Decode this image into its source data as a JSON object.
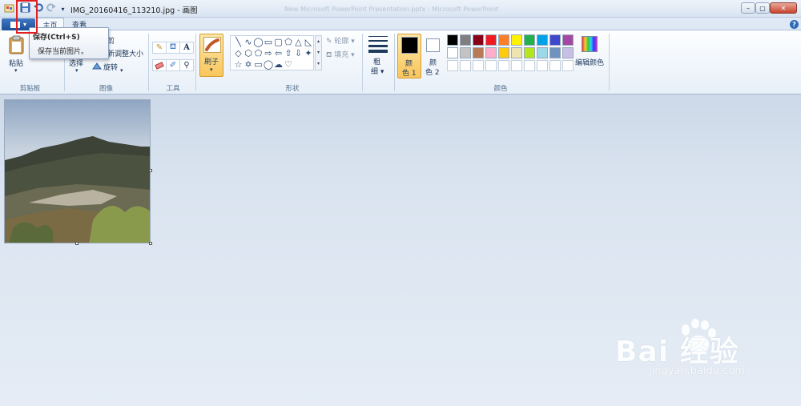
{
  "window": {
    "title": "IMG_20160416_113210.jpg - 画图",
    "ghost_title": "New Microsoft PowerPoint Presentation.pptx - Microsoft PowerPoint",
    "minimize_label": "–",
    "maximize_label": "▢",
    "close_label": "✕"
  },
  "qat": {
    "save_icon": "save-icon",
    "undo_icon": "undo-icon",
    "redo_icon": "redo-icon",
    "customize_label": "▾"
  },
  "tabs": {
    "file_label": "▾",
    "home": "主页",
    "view": "查看",
    "help": "?"
  },
  "tooltip": {
    "title": "保存(Ctrl+S)",
    "description": "保存当前图片。"
  },
  "clipboard": {
    "paste": "粘贴",
    "cut_partial": "剪",
    "group": "剪贴板"
  },
  "image": {
    "select": "选择",
    "resize": "新调整大小",
    "rotate": "旋转",
    "group": "图像"
  },
  "tools": {
    "group": "工具",
    "text_tool": "A"
  },
  "brushes": {
    "label": "刷子"
  },
  "shapes": {
    "outline": "轮廓",
    "fill": "填充",
    "group": "形状",
    "glyphs": [
      "╲",
      "∿",
      "◯",
      "▭",
      "▢",
      "⬠",
      "△",
      "◺",
      "◇",
      "⬡",
      "⬠",
      "⇨",
      "⇦",
      "⇧",
      "⇩",
      "✦",
      "☆",
      "✡",
      "▭",
      "◯",
      "☁",
      "♡"
    ]
  },
  "size": {
    "label1": "粗",
    "label2": "细"
  },
  "colors": {
    "color1_label1": "颜",
    "color1_label2": "色 1",
    "color2_label1": "颜",
    "color2_label2": "色 2",
    "edit": "编辑颜色",
    "group": "颜色",
    "color1_value": "#000000",
    "color2_value": "#ffffff",
    "palette_row1": [
      "#000000",
      "#7f7f7f",
      "#880015",
      "#ed1c24",
      "#ff7f27",
      "#fff200",
      "#22b14c",
      "#00a2e8",
      "#3f48cc",
      "#a349a4"
    ],
    "palette_row2": [
      "#ffffff",
      "#c3c3c3",
      "#b97a57",
      "#ffaec9",
      "#ffc90e",
      "#efe4b0",
      "#b5e61d",
      "#99d9ea",
      "#7092be",
      "#c8bfe7"
    ]
  },
  "watermark": {
    "brand": "Bai 经验",
    "url": "jingyan.baidu.com"
  }
}
